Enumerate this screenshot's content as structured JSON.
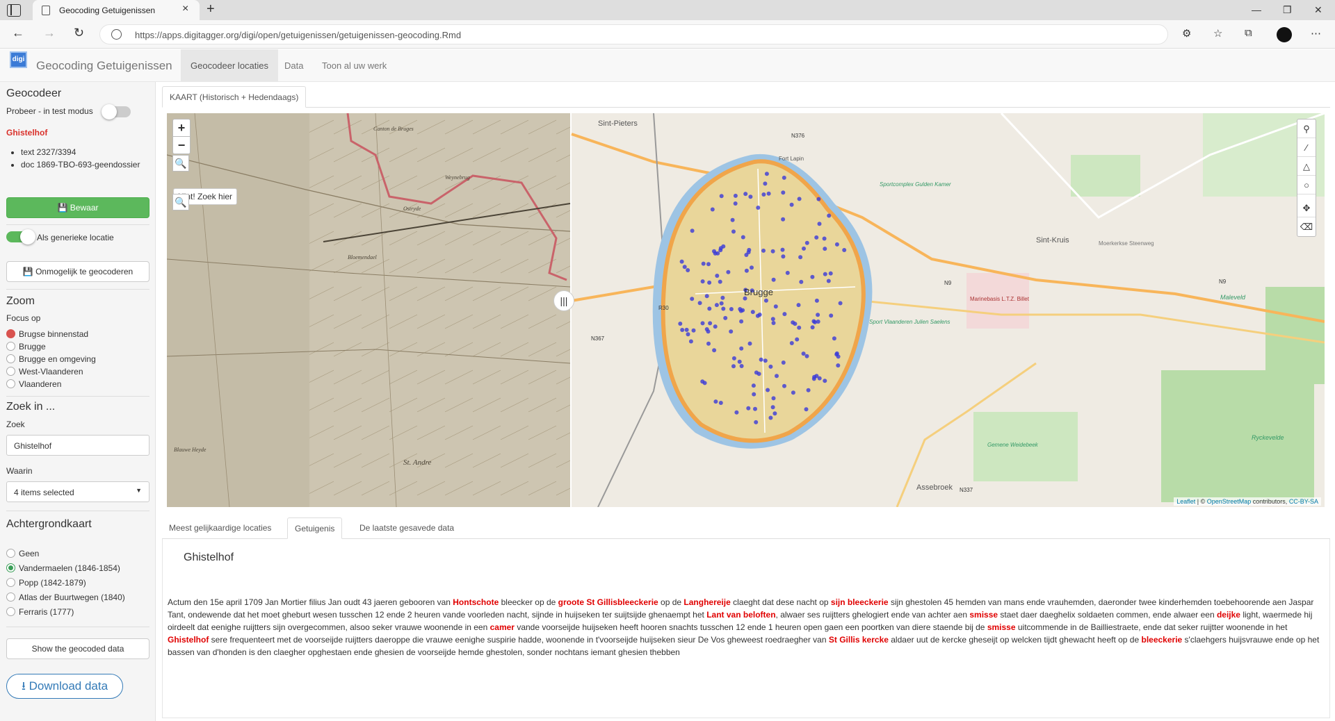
{
  "browser": {
    "tab_title": "Geocoding Getuigenissen",
    "url": "https://apps.digitagger.org/digi/open/getuigenissen/getuigenissen-geocoding.Rmd"
  },
  "app": {
    "logo_text": "digi",
    "title": "Geocoding Getuigenissen",
    "nav": [
      "Geocodeer locaties",
      "Data",
      "Toon al uw werk"
    ]
  },
  "sidebar": {
    "geocodeer_title": "Geocodeer",
    "test_mode_label": "Probeer - in test modus",
    "location_name": "Ghistelhof",
    "info": [
      "text 2327/3394",
      "doc 1869-TBO-693-geendossier"
    ],
    "save_label": "Bewaar",
    "generic_label": "Als generieke locatie",
    "impossible_label": "Onmogelijk te geocoderen",
    "zoom_title": "Zoom",
    "focus_label": "Focus op",
    "focus_options": [
      "Brugse binnenstad",
      "Brugge",
      "Brugge en omgeving",
      "West-Vlaanderen",
      "Vlaanderen"
    ],
    "search_title": "Zoek in ...",
    "search_label": "Zoek",
    "search_value": "Ghistelhof",
    "where_label": "Waarin",
    "where_value": "4 items selected",
    "bg_title": "Achtergrondkaart",
    "bg_options": [
      "Geen",
      "Vandermaelen (1846-1854)",
      "Popp (1842-1879)",
      "Atlas der Buurtwegen (1840)",
      "Ferraris (1777)"
    ],
    "show_label": "Show the geocoded data",
    "download_label": "Download data"
  },
  "map": {
    "tab": "KAART (Historisch + Hedendaags)",
    "hint": "Hint! Zoek hier",
    "attribution_leaflet": "Leaflet",
    "attribution_osm": "OpenStreetMap",
    "attribution_mid": " contributors, ",
    "attribution_cc": "CC-BY-SA",
    "labels": {
      "sint_pieters": "Sint-Pieters",
      "sint_kruis": "Sint-Kruis",
      "brugge": "Brugge",
      "assebroek": "Assebroek",
      "n376": "N376",
      "n9": "N9",
      "n367": "N367",
      "n337": "N337",
      "r30": "R30",
      "marinebasis": "Marinebasis L.T.Z. Billet",
      "maleveld": "Maleveld",
      "ryckevelde": "Ryckevelde",
      "gemene_weidebeek": "Gemene Weidebeek",
      "sportcomplex": "Sportcomplex Gulden Kamer",
      "sport_vlaanderen": "Sport Vlaanderen Julien Saelens",
      "moerkerkse": "Moerkerkse Steenweg",
      "fort_lapin": "Fort Lapin",
      "hist_canton": "Canton de Bruges",
      "hist_ostryde": "Ostryde",
      "hist_weynebrug": "Weynebrug",
      "hist_blauwe_heyde": "Blauwe Heyde",
      "hist_sint_andre": "St. Andre",
      "hist_bloemendael": "Bloemendael"
    }
  },
  "tabs_bottom": [
    "Meest gelijkaardige locaties",
    "Getuigenis",
    "De laatste gesavede data"
  ],
  "testimony": {
    "title": "Ghistelhof",
    "p": [
      "Actum den 15e april 1709 Jan Mortier filius Jan oudt 43 jaeren gebooren van ",
      "Hontschote",
      " bleecker op de ",
      "groote St Gillisbleeckerie",
      " op de ",
      "Langhereije",
      " claeght dat dese nacht op ",
      "sijn bleeckerie",
      " sijn ghestolen 45 hemden van mans ende vrauhemden, daeronder twee kinderhemden toebehoorende aen Jaspar Tant, ondewende dat het moet gheburt wesen tusschen 12 ende 2 heuren vande voorleden nacht, sijnde in huijseken ter suijtsijde ghenaempt het ",
      "Lant van beloften",
      ", alwaer ses ruijtters ghelogiert ende van achter aen ",
      "smisse",
      " staet daer daeghelix soldaeten commen, ende alwaer een ",
      "deijke",
      " light, waermede hij oirdeelt dat eenighe ruijtters sijn overgecommen, alsoo seker vrauwe woonende in een ",
      "camer",
      " vande voorseijde huijseken heeft hooren snachts tusschen 12 ende 1 heuren open gaen een poortken van diere staende bij de ",
      "smisse",
      " uitcommende in de Bailliestraete, ende dat seker ruijtter woonende in het ",
      "Ghistelhof",
      " sere frequenteert met de voorseijde ruijtters daeroppe die vrauwe eenighe suspirie hadde, woonende in t'voorseijde huijseken sieur De Vos gheweest roedraegher van ",
      "St Gillis kercke",
      " aldaer uut de kercke gheseijt op welcken tijdt ghewacht heeft op de ",
      "bleeckerie",
      " s'claehgers huijsvrauwe ende op het bassen van d'honden is den claegher opghestaen ende ghesien de voorseijde hemde ghestolen, sonder nochtans iemant ghesien thebben"
    ]
  },
  "colors": {
    "accent": "#337ab7",
    "green": "#5cb85c",
    "red": "#e00000"
  }
}
